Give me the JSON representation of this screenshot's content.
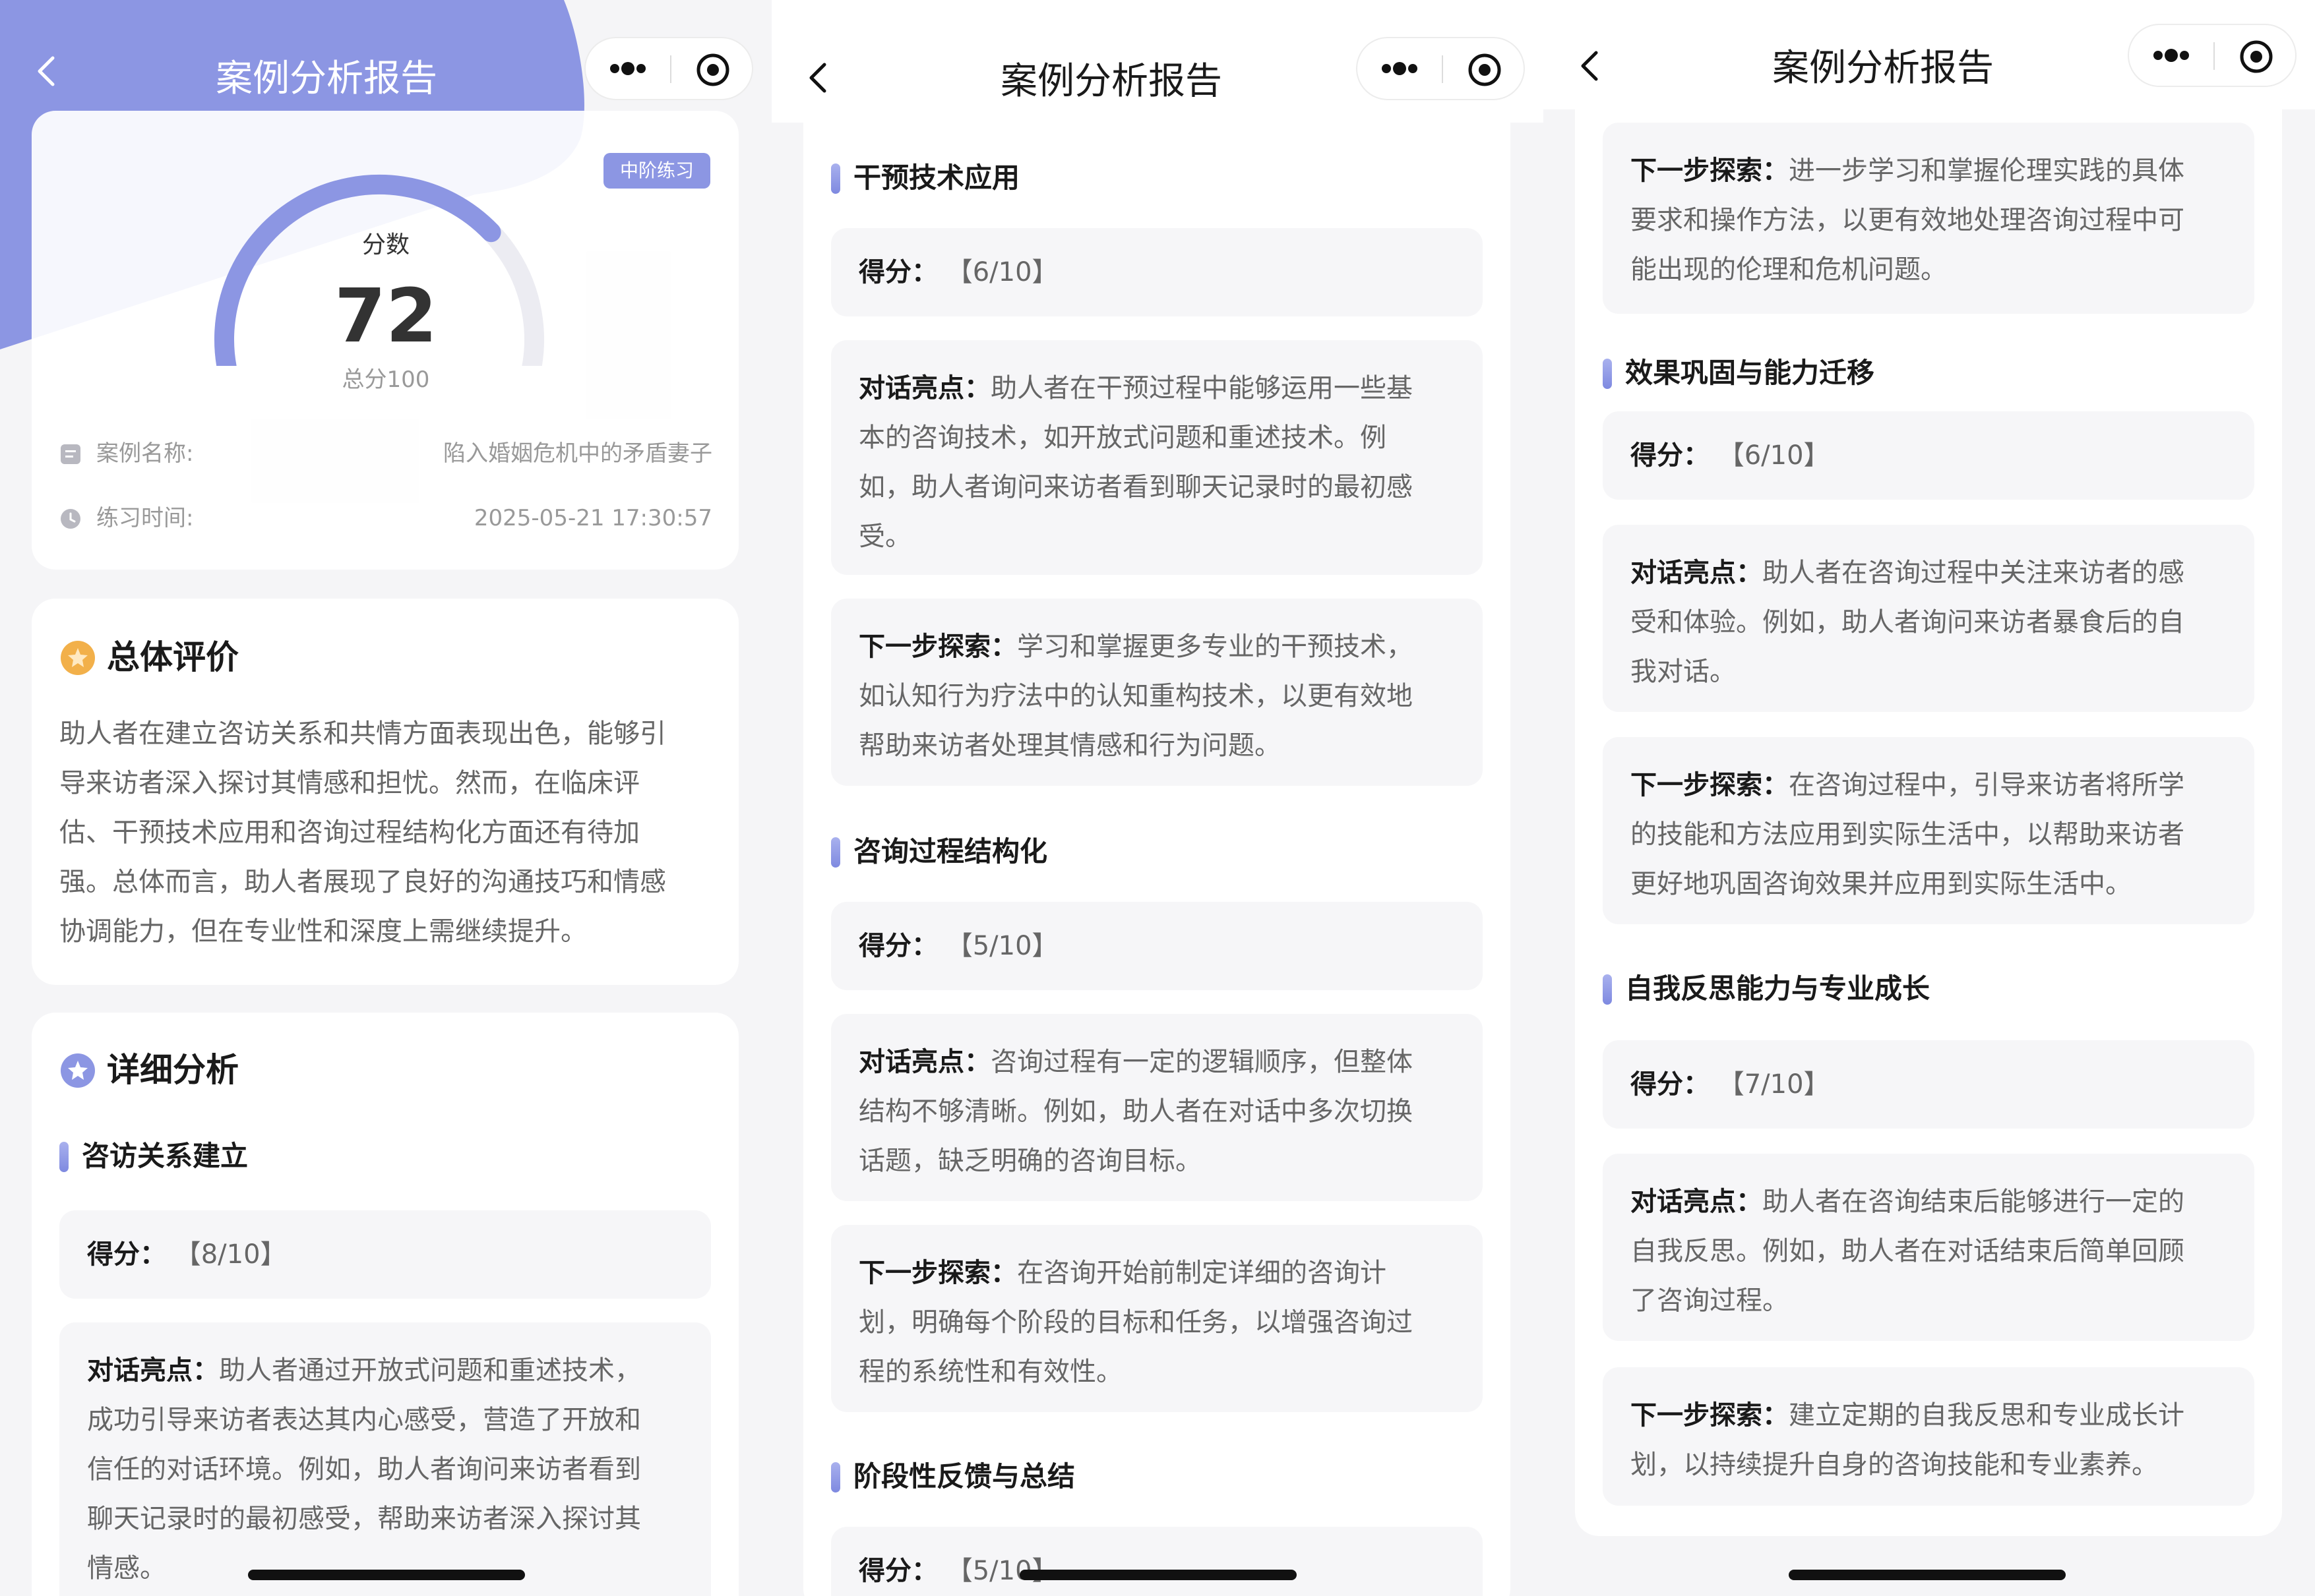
{
  "nav": {
    "title": "案例分析报告"
  },
  "summary": {
    "badge": "中阶练习",
    "score_label": "分数",
    "score": 72,
    "max_score": 100,
    "score_total": "总分100",
    "case_name_label": "案例名称:",
    "case_name": "陷入婚姻危机中的矛盾妻子",
    "time_label": "练习时间:",
    "time": "2025-05-21 17:30:57"
  },
  "overall": {
    "title": "总体评价",
    "lines": [
      "助人者在建立咨访关系和共情方面表现出色，能够引",
      "导来访者深入探讨其情感和担忧。然而，在临床评",
      "估、干预技术应用和咨询过程结构化方面还有待加",
      "强。总体而言，助人者展现了良好的沟通技巧和情感",
      "协调能力，但在专业性和深度上需继续提升。"
    ]
  },
  "detail": {
    "title": "详细分析",
    "labels": {
      "score": "得分：",
      "highlight": "对话亮点：",
      "next": "下一步探索："
    },
    "sections": [
      {
        "title": "咨访关系建立",
        "score": "【8/10】",
        "highlight": [
          "助人者通过开放式问题和重述技术，",
          "成功引导来访者表达其内心感受，营造了开放和",
          "信任的对话环境。例如，助人者询问来访者看到",
          "聊天记录时的最初感受，帮助来访者深入探讨其",
          "情感。"
        ]
      },
      {
        "title": "干预技术应用",
        "score": "【6/10】",
        "highlight": [
          "助人者在干预过程中能够运用一些基",
          "本的咨询技术，如开放式问题和重述技术。例",
          "如，助人者询问来访者看到聊天记录时的最初感",
          "受。"
        ],
        "next": [
          "学习和掌握更多专业的干预技术，",
          "如认知行为疗法中的认知重构技术，以更有效地",
          "帮助来访者处理其情感和行为问题。"
        ]
      },
      {
        "title": "咨询过程结构化",
        "score": "【5/10】",
        "highlight": [
          "咨询过程有一定的逻辑顺序，但整体",
          "结构不够清晰。例如，助人者在对话中多次切换",
          "话题，缺乏明确的咨询目标。"
        ],
        "next": [
          "在咨询开始前制定详细的咨询计",
          "划，明确每个阶段的目标和任务，以增强咨询过",
          "程的系统性和有效性。"
        ]
      },
      {
        "title": "阶段性反馈与总结",
        "score": "【5/10】"
      },
      {
        "next": [
          "进一步学习和掌握伦理实践的具体",
          "要求和操作方法，以更有效地处理咨询过程中可",
          "能出现的伦理和危机问题。"
        ]
      },
      {
        "title": "效果巩固与能力迁移",
        "score": "【6/10】",
        "highlight": [
          "助人者在咨询过程中关注来访者的感",
          "受和体验。例如，助人者询问来访者暴食后的自",
          "我对话。"
        ],
        "next": [
          "在咨询过程中，引导来访者将所学",
          "的技能和方法应用到实际生活中，以帮助来访者",
          "更好地巩固咨询效果并应用到实际生活中。"
        ]
      },
      {
        "title": "自我反思能力与专业成长",
        "score": "【7/10】",
        "highlight": [
          "助人者在咨询结束后能够进行一定的",
          "自我反思。例如，助人者在对话结束后简单回顾",
          "了咨询过程。"
        ],
        "next": [
          "建立定期的自我反思和专业成长计",
          "划，以持续提升自身的咨询技能和专业素养。"
        ]
      }
    ]
  },
  "colors": {
    "accent": "#8c96e3",
    "page_bg": "#f5f5f7",
    "card_bg": "#ffffff",
    "box_bg": "#f6f6f8"
  },
  "icons": [
    "back-arrow-icon",
    "more-dots-icon",
    "target-circle-icon",
    "document-icon",
    "clock-icon",
    "star-badge-icon"
  ]
}
